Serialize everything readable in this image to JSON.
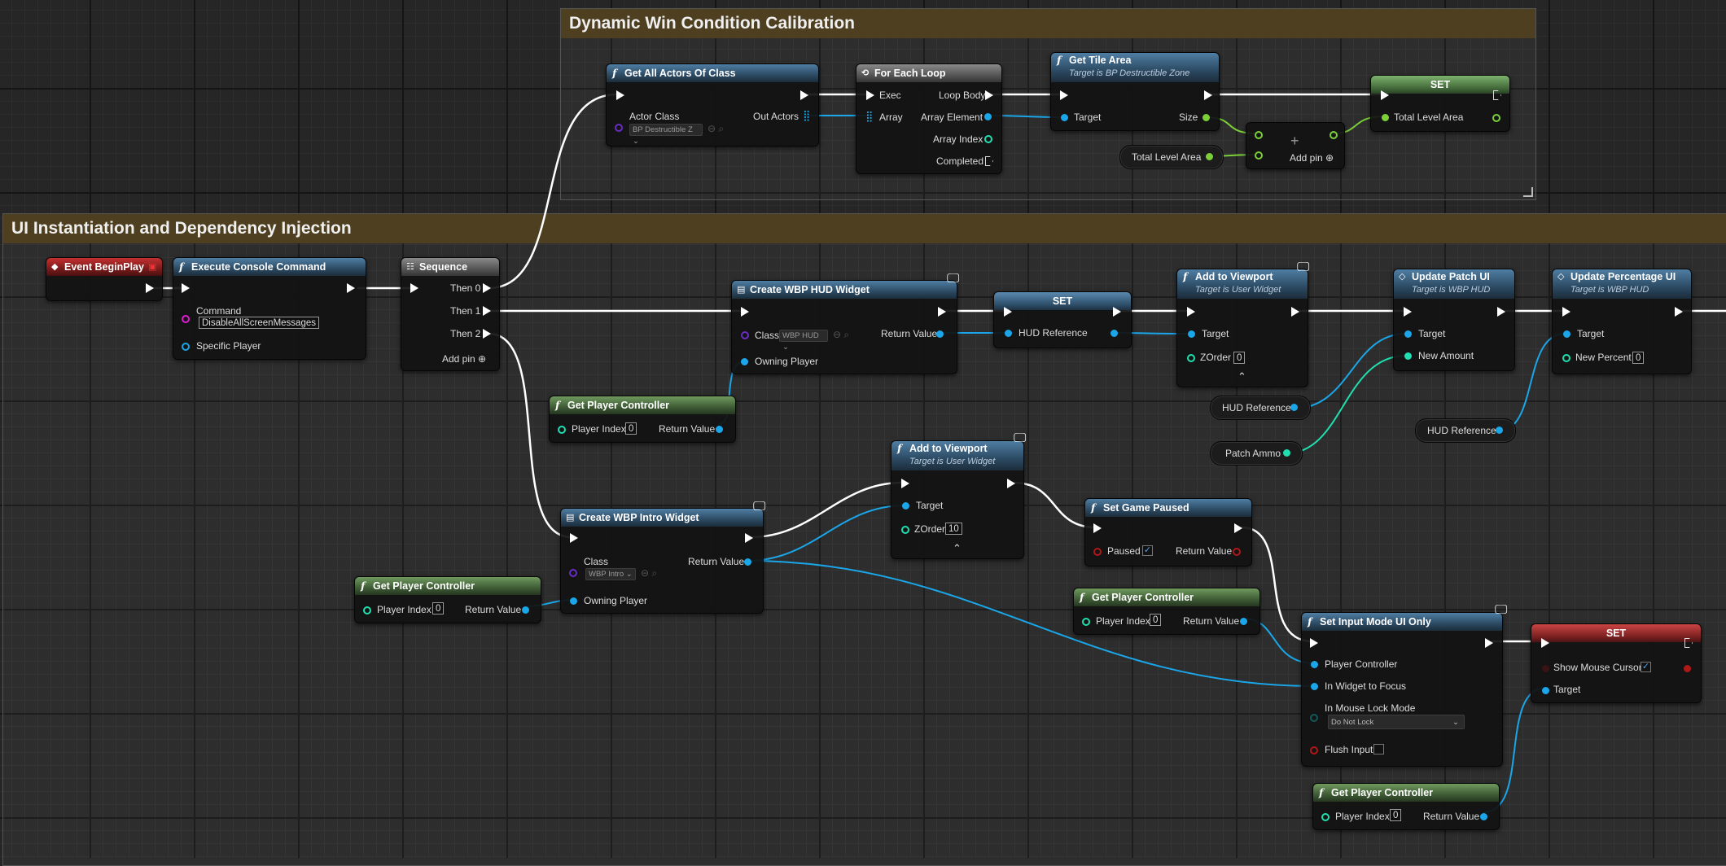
{
  "comments": {
    "calibration": "Dynamic Win Condition Calibration",
    "ui": "UI Instantiation and Dependency Injection"
  },
  "colors": {
    "exec": "#ffffff",
    "object": "#1aa6e8",
    "integer": "#1fe0b0",
    "float": "#7bd03a",
    "bool": "#b01818",
    "class": "#6a2cc7",
    "string": "#e11ad5"
  },
  "nodes": {
    "get_all_actors": {
      "title": "Get All Actors Of Class",
      "actor_class": "Actor Class",
      "class_value": "BP Destructible Z",
      "out_actors": "Out Actors"
    },
    "for_each": {
      "title": "For Each Loop",
      "exec": "Exec",
      "loop_body": "Loop Body",
      "array": "Array",
      "array_element": "Array Element",
      "array_index": "Array Index",
      "completed": "Completed"
    },
    "get_tile_area": {
      "title": "Get Tile Area",
      "subtitle": "Target is BP Destructible Zone",
      "target": "Target",
      "size": "Size"
    },
    "set_total": {
      "title": "SET",
      "label": "Total Level Area"
    },
    "add": {
      "symbol": "+",
      "add_pin": "Add pin"
    },
    "total_level_area_var": "Total Level Area",
    "event_begin_play": {
      "title": "Event BeginPlay"
    },
    "exec_console": {
      "title": "Execute Console Command",
      "command": "Command",
      "command_value": "DisableAllScreenMessages",
      "specific_player": "Specific Player"
    },
    "sequence": {
      "title": "Sequence",
      "then0": "Then 0",
      "then1": "Then 1",
      "then2": "Then 2",
      "add_pin": "Add pin"
    },
    "create_hud": {
      "title": "Create WBP HUD Widget",
      "class": "Class",
      "class_value": "WBP HUD",
      "return_value": "Return Value",
      "owning_player": "Owning Player"
    },
    "set_hud": {
      "title": "SET",
      "label": "HUD Reference"
    },
    "add_viewport_1": {
      "title": "Add to Viewport",
      "subtitle": "Target is User Widget",
      "target": "Target",
      "zorder": "ZOrder",
      "zorder_value": "0"
    },
    "update_patch": {
      "title": "Update Patch UI",
      "subtitle": "Target is WBP HUD",
      "target": "Target",
      "new_amount": "New Amount"
    },
    "update_percent": {
      "title": "Update Percentage UI",
      "subtitle": "Target is WBP HUD",
      "target": "Target",
      "new_percent": "New Percent",
      "new_percent_value": "0"
    },
    "hud_ref_var_1": "HUD Reference",
    "patch_ammo_var": "Patch Ammo",
    "hud_ref_var_2": "HUD Reference",
    "get_pc_1": {
      "title": "Get Player Controller",
      "player_index": "Player Index",
      "index_value": "0",
      "return_value": "Return Value"
    },
    "add_viewport_2": {
      "title": "Add to Viewport",
      "subtitle": "Target is User Widget",
      "target": "Target",
      "zorder": "ZOrder",
      "zorder_value": "10"
    },
    "create_intro": {
      "title": "Create WBP Intro Widget",
      "class": "Class",
      "class_value": "WBP Intro",
      "return_value": "Return Value",
      "owning_player": "Owning Player"
    },
    "get_pc_2": {
      "title": "Get Player Controller",
      "player_index": "Player Index",
      "index_value": "0",
      "return_value": "Return Value"
    },
    "set_game_paused": {
      "title": "Set Game Paused",
      "paused": "Paused",
      "return_value": "Return Value"
    },
    "get_pc_3": {
      "title": "Get Player Controller",
      "player_index": "Player Index",
      "index_value": "0",
      "return_value": "Return Value"
    },
    "set_input_mode": {
      "title": "Set Input Mode UI Only",
      "player_controller": "Player Controller",
      "widget_focus": "In Widget to Focus",
      "mouse_lock": "In Mouse Lock Mode",
      "mouse_lock_value": "Do Not Lock",
      "flush_input": "Flush Input"
    },
    "set_cursor": {
      "title": "SET",
      "show_cursor": "Show Mouse Cursor",
      "target": "Target"
    },
    "get_pc_4": {
      "title": "Get Player Controller",
      "player_index": "Player Index",
      "index_value": "0",
      "return_value": "Return Value"
    }
  }
}
